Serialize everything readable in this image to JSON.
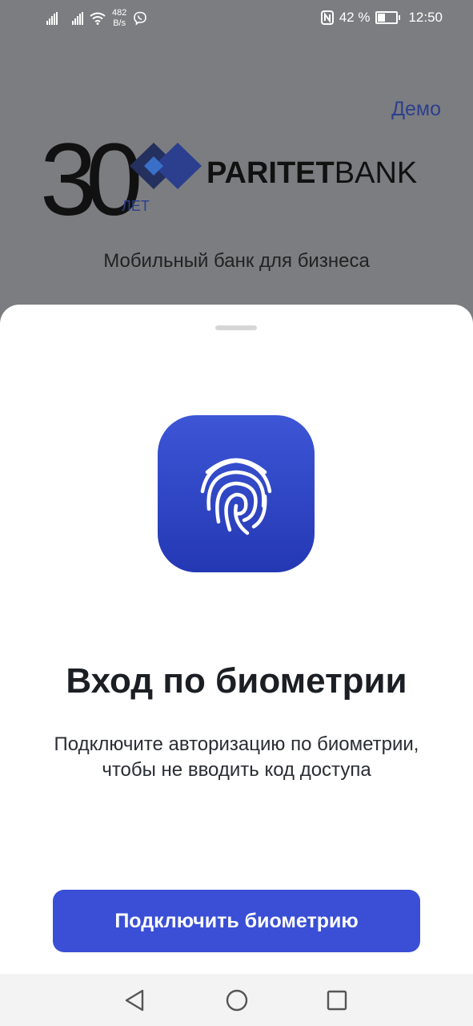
{
  "status_bar": {
    "net_speed_value": "482",
    "net_speed_unit": "B/s",
    "battery_percent": "42 %",
    "time": "12:50",
    "icons": [
      "signal-icon",
      "signal-icon",
      "wifi-icon",
      "viber-icon",
      "nfc-icon",
      "battery-icon"
    ]
  },
  "header": {
    "demo_label": "Демо",
    "logo": {
      "anniversary_number": "30",
      "anniversary_word": "ЛЕТ",
      "brand_bold": "PARITET",
      "brand_light": "BANK"
    },
    "subtitle": "Мобильный банк для бизнеса"
  },
  "sheet": {
    "icon": "fingerprint-icon",
    "title": "Вход по биометрии",
    "description": "Подключите авторизацию по биометрии, чтобы не вводить код доступа",
    "button_label": "Подключить биометрию"
  },
  "nav_bar": {
    "icons": [
      "back-icon",
      "home-icon",
      "recents-icon"
    ]
  },
  "colors": {
    "accent": "#3a4fd6",
    "overlay_background": "#7c7d80",
    "demo_link": "#2c3f8f"
  }
}
